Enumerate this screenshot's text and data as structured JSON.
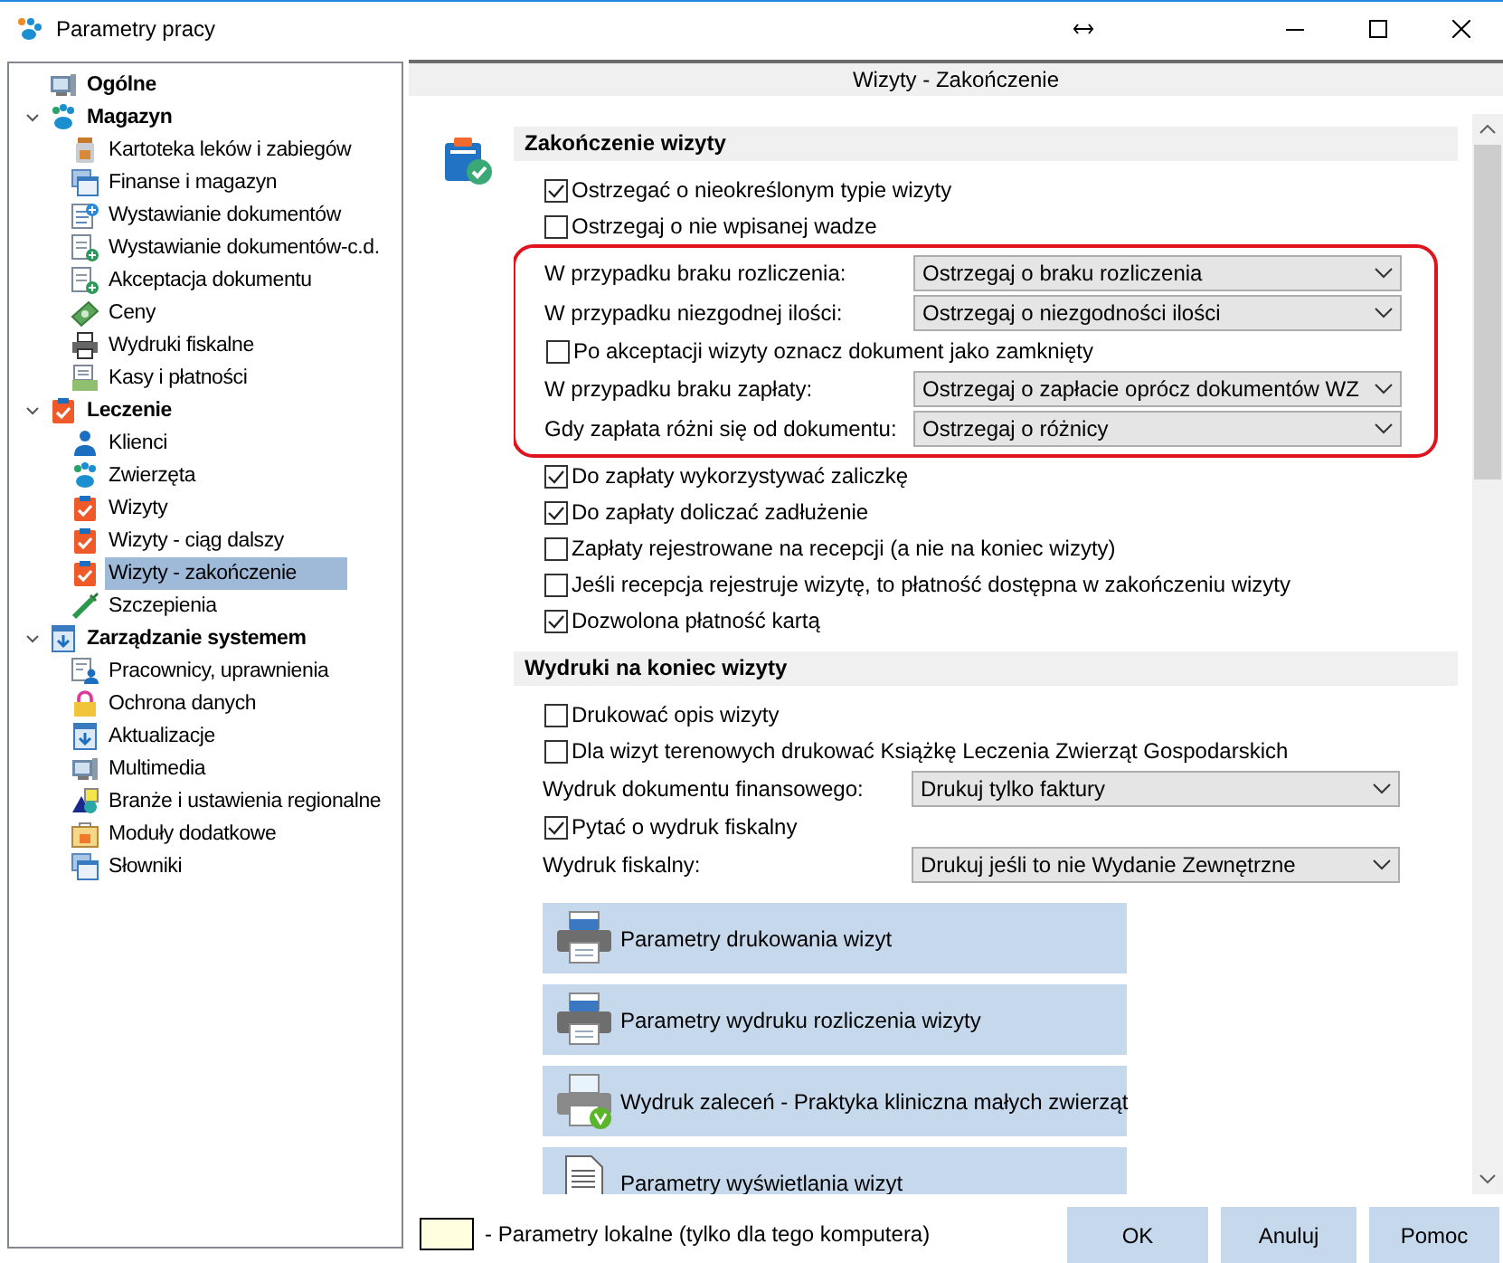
{
  "window": {
    "title": "Parametry pracy"
  },
  "tree": [
    {
      "label": "Ogólne",
      "kind": "monitor",
      "selected": false
    },
    {
      "label": "Magazyn",
      "kind": "paw",
      "expanded": true,
      "selected": false,
      "children": [
        {
          "label": "Kartoteka leków i zabiegów",
          "kind": "jar",
          "selected": false
        },
        {
          "label": "Finanse i magazyn",
          "kind": "windows",
          "selected": false
        },
        {
          "label": "Wystawianie dokumentów",
          "kind": "docplus",
          "selected": false
        },
        {
          "label": "Wystawianie dokumentów-c.d.",
          "kind": "docgreen",
          "selected": false
        },
        {
          "label": "Akceptacja dokumentu",
          "kind": "docgreen",
          "selected": false
        },
        {
          "label": "Ceny",
          "kind": "money",
          "selected": false
        },
        {
          "label": "Wydruki fiskalne",
          "kind": "printer",
          "selected": false
        },
        {
          "label": "Kasy i płatności",
          "kind": "cash",
          "selected": false
        }
      ]
    },
    {
      "label": "Leczenie",
      "kind": "clipboard",
      "expanded": true,
      "selected": false,
      "children": [
        {
          "label": "Klienci",
          "kind": "person",
          "selected": false
        },
        {
          "label": "Zwierzęta",
          "kind": "paw",
          "selected": false
        },
        {
          "label": "Wizyty",
          "kind": "clipboard",
          "selected": false
        },
        {
          "label": "Wizyty - ciąg dalszy",
          "kind": "clipboard",
          "selected": false
        },
        {
          "label": "Wizyty - zakończenie",
          "kind": "clipboard",
          "selected": true
        },
        {
          "label": "Szczepienia",
          "kind": "syringe",
          "selected": false
        }
      ]
    },
    {
      "label": "Zarządzanie systemem",
      "kind": "download",
      "expanded": true,
      "selected": false,
      "children": [
        {
          "label": "Pracownicy, uprawnienia",
          "kind": "userdoc",
          "selected": false
        },
        {
          "label": "Ochrona danych",
          "kind": "lock",
          "selected": false
        },
        {
          "label": "Aktualizacje",
          "kind": "download",
          "selected": false
        },
        {
          "label": "Multimedia",
          "kind": "monitor",
          "selected": false
        },
        {
          "label": "Branże i ustawienia regionalne",
          "kind": "shapes",
          "selected": false
        },
        {
          "label": "Moduły dodatkowe",
          "kind": "package",
          "selected": false
        },
        {
          "label": "Słowniki",
          "kind": "windows",
          "selected": false
        }
      ]
    }
  ],
  "page_title": "Wizyty -  Zakończenie",
  "sections": [
    {
      "title": "Zakończenie wizyty",
      "rows": [
        {
          "kind": "checkbox",
          "label": "Ostrzegać o nieokreślonym typie wizyty",
          "checked": true
        },
        {
          "kind": "checkbox",
          "label": "Ostrzegaj o nie wpisanej wadze",
          "checked": false
        },
        {
          "kind": "group",
          "outlined": true,
          "rows": [
            {
              "kind": "select",
              "label": "W przypadku braku rozliczenia:",
              "value": "Ostrzegaj o braku rozliczenia"
            },
            {
              "kind": "select",
              "label": "W przypadku niezgodnej ilości:",
              "value": "Ostrzegaj o niezgodności ilości"
            },
            {
              "kind": "checkbox",
              "label": "Po akceptacji wizyty oznacz dokument jako zamknięty",
              "checked": false
            },
            {
              "kind": "select",
              "label": "W przypadku braku zapłaty:",
              "value": "Ostrzegaj o zapłacie oprócz dokumentów WZ"
            },
            {
              "kind": "select",
              "label": "Gdy zapłata różni się od dokumentu:",
              "value": "Ostrzegaj o różnicy"
            }
          ]
        },
        {
          "kind": "checkbox",
          "label": "Do zapłaty wykorzystywać zaliczkę",
          "checked": true
        },
        {
          "kind": "checkbox",
          "label": "Do zapłaty doliczać zadłużenie",
          "checked": true
        },
        {
          "kind": "checkbox",
          "label": "Zapłaty rejestrowane na recepcji (a nie na koniec wizyty)",
          "checked": false
        },
        {
          "kind": "checkbox",
          "label": "Jeśli recepcja rejestruje wizytę, to płatność dostępna w zakończeniu wizyty",
          "checked": false
        },
        {
          "kind": "checkbox",
          "label": "Dozwolona płatność kartą",
          "checked": true
        }
      ]
    },
    {
      "title": "Wydruki na koniec wizyty",
      "rows": [
        {
          "kind": "checkbox",
          "label": "Drukować opis wizyty",
          "checked": false
        },
        {
          "kind": "checkbox",
          "label": "Dla wizyt terenowych drukować Książkę Leczenia Zwierząt Gospodarskich",
          "checked": false
        },
        {
          "kind": "select",
          "label": "Wydruk dokumentu finansowego:",
          "value": "Drukuj tylko faktury"
        },
        {
          "kind": "checkbox",
          "label": "Pytać o wydruk fiskalny",
          "checked": true
        },
        {
          "kind": "select",
          "label": "Wydruk fiskalny:",
          "value": "Drukuj jeśli to nie Wydanie Zewnętrzne"
        }
      ]
    }
  ],
  "action_buttons": [
    {
      "label": "Parametry drukowania wizyt",
      "kind": "printer"
    },
    {
      "label": "Parametry wydruku rozliczenia wizyty",
      "kind": "printer"
    },
    {
      "label": "Wydruk zaleceń - Praktyka kliniczna małych zwierząt",
      "kind": "printerv"
    },
    {
      "label": "Parametry wyświetlania wizyt",
      "kind": "document"
    }
  ],
  "footer": {
    "legend": "- Parametry lokalne (tylko dla tego komputera)",
    "buttons": [
      "OK",
      "Anuluj",
      "Pomoc"
    ]
  }
}
